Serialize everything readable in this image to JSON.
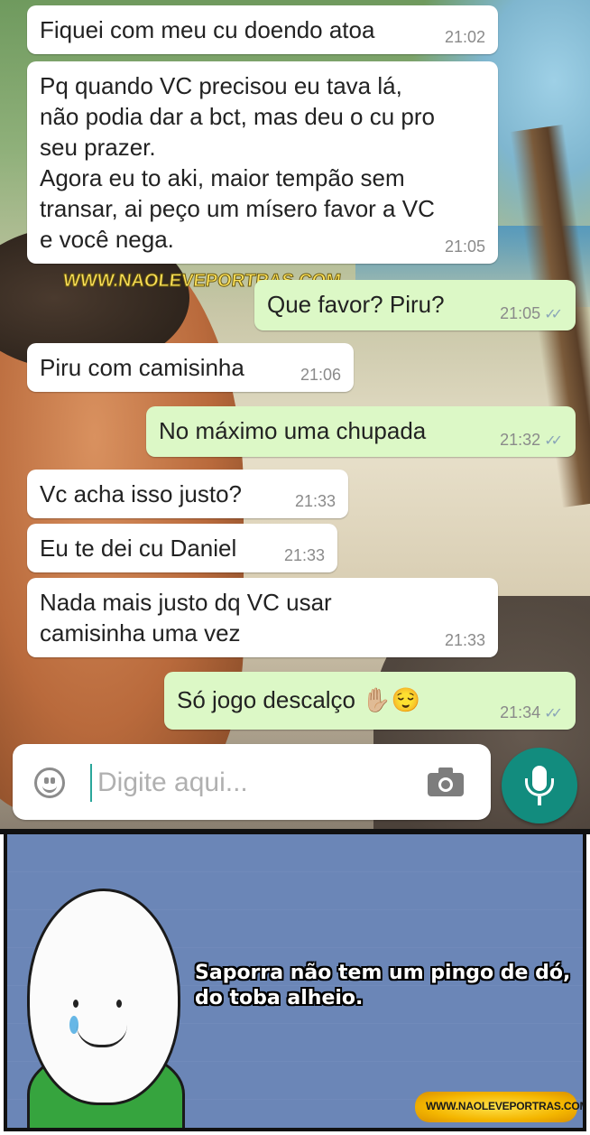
{
  "chat": {
    "messages": [
      {
        "dir": "in",
        "text": "Fiquei com meu cu doendo atoa",
        "time": "21:02"
      },
      {
        "dir": "in",
        "text": "Pq quando VC precisou eu tava lá,\nnão podia dar a bct, mas deu o cu pro\nseu prazer.\nAgora eu to aki, maior tempão sem\ntransar, ai peço um mísero favor a VC\ne você nega.",
        "time": "21:05"
      },
      {
        "dir": "out",
        "text": "Que favor? Piru?",
        "time": "21:05"
      },
      {
        "dir": "in",
        "text": "Piru com camisinha",
        "time": "21:06"
      },
      {
        "dir": "out",
        "text": "No máximo uma chupada",
        "time": "21:32"
      },
      {
        "dir": "in",
        "text": "Vc acha isso justo?",
        "time": "21:33"
      },
      {
        "dir": "in",
        "text": "Eu te dei cu Daniel",
        "time": "21:33"
      },
      {
        "dir": "in",
        "text": "Nada mais justo dq VC usar\ncamisinha uma vez",
        "time": "21:33"
      },
      {
        "dir": "out",
        "text": "Só jogo descalço ✋🏼😌",
        "time": "21:34"
      }
    ],
    "read_ticks": "✓✓",
    "watermark": "WWW.NAOLEVEPORTRAS.COM"
  },
  "input": {
    "placeholder": "Digite aqui...",
    "value": ""
  },
  "icons": {
    "emoji": "emoji-icon",
    "camera": "camera-icon",
    "mic": "microphone-icon"
  },
  "meme": {
    "caption": "Saporra não tem um pingo de dó,\ndo toba alheio.",
    "logo": "WWW.NAOLEVEPORTRAS.COM"
  },
  "colors": {
    "incoming_bubble": "#ffffff",
    "outgoing_bubble": "#dcf8c6",
    "mic_button": "#128c7e",
    "meme_background": "#6b86b7",
    "shirt": "#36a43e"
  }
}
